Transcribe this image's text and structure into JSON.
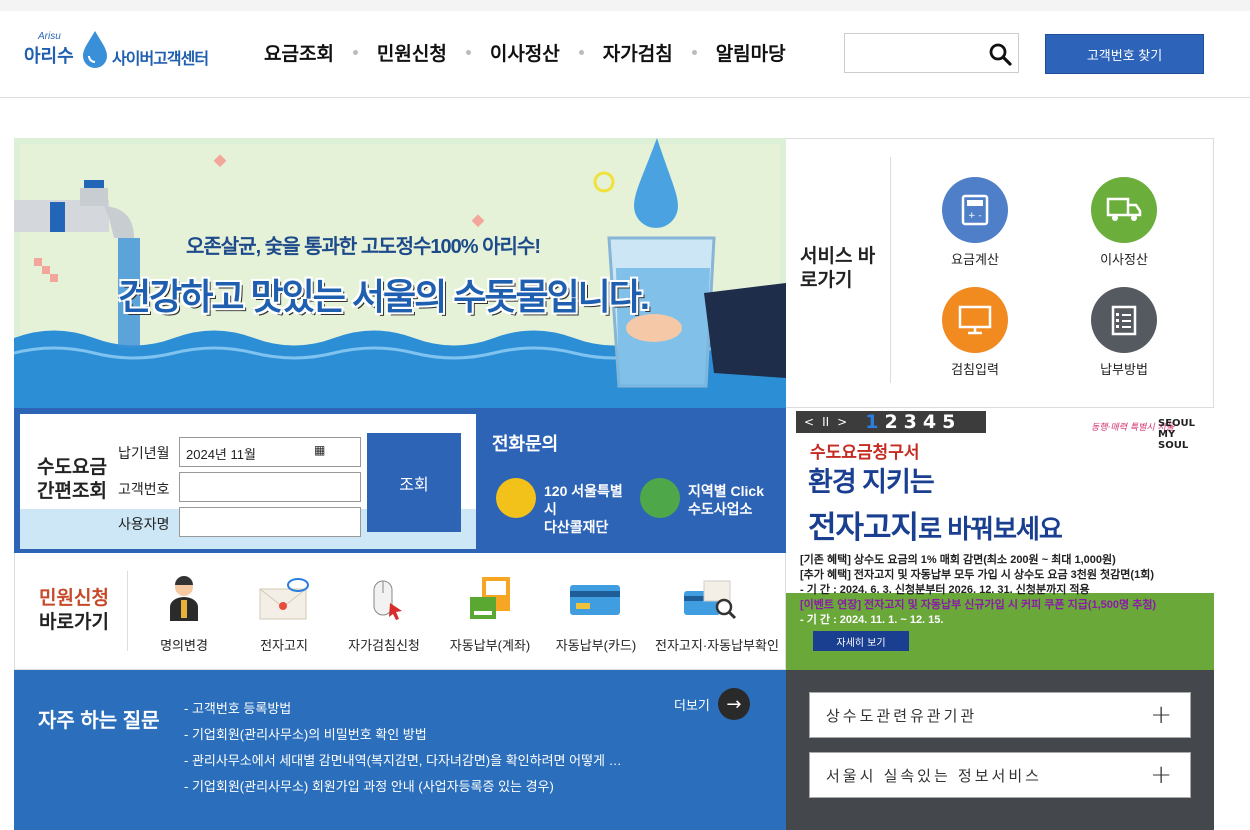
{
  "header": {
    "logo_small": "Arisu",
    "logo_arisu": "아리수",
    "logo_center": "사이버고객센터",
    "nav": [
      "요금조회",
      "민원신청",
      "이사정산",
      "자가검침",
      "알림마당"
    ],
    "search_placeholder": "",
    "customer_button": "고객번호 찾기"
  },
  "banner": {
    "subtitle": "오존살균, 숯을 통과한 고도정수100% 아리수!",
    "main": "건강하고 맛있는 서울의 수돗물입니다."
  },
  "service": {
    "title": "서비스 바로가기",
    "items": [
      {
        "label": "요금계산",
        "color": "#4f7fc8",
        "icon": "calculator-icon"
      },
      {
        "label": "이사정산",
        "color": "#6cae3c",
        "icon": "truck-icon"
      },
      {
        "label": "검침입력",
        "color": "#f18a1f",
        "icon": "monitor-icon"
      },
      {
        "label": "납부방법",
        "color": "#555a61",
        "icon": "checklist-icon"
      }
    ]
  },
  "quick_search": {
    "title": "수도요금 간편조회",
    "fields": [
      {
        "label": "납기년월",
        "value": "2024년 11월"
      },
      {
        "label": "고객번호",
        "value": ""
      },
      {
        "label": "사용자명",
        "value": ""
      }
    ],
    "button": "조회"
  },
  "phone": {
    "title": "전화문의",
    "items": [
      {
        "line1": "120 서울특별시",
        "line2": "다산콜재단"
      },
      {
        "line1": "지역별 Click",
        "line2": "수도사업소"
      }
    ]
  },
  "ebill": {
    "controls": [
      "<",
      "II",
      ">"
    ],
    "pages": [
      "1",
      "2",
      "3",
      "4",
      "5"
    ],
    "active_page": "1",
    "seoul_logo": "동행·매력 특별시 서울",
    "seoul_brand": "SEOUL MY SOUL",
    "title1": "수도요금청구서",
    "title2": "환경 지키는",
    "title3a": "전자고지",
    "title3b": "로 바꿔보세요",
    "lines": [
      "[기존 혜택] 상수도 요금의 1% 매회 감면(최소 200원 ~ 최대 1,000원)",
      "[추가 혜택] 전자고지 및 자동납부 모두 가입 시 상수도 요금 3천원 첫감면(1회)",
      " - 기 간 : 2024. 6. 3. 신청분부터 2026. 12. 31. 신청분까지 적용",
      "[이벤트 연장] 전자고지 및 자동납부 신규가입 시 커피 쿠폰 지급(1,500명 추첨)",
      " - 기 간 : 2024. 11. 1. ~ 12. 15."
    ],
    "detail_button": "자세히 보기"
  },
  "civil": {
    "title_red": "민원신청",
    "title": "바로가기",
    "items": [
      {
        "label": "명의변경",
        "icon": "person-icon"
      },
      {
        "label": "전자고지",
        "icon": "email-icon"
      },
      {
        "label": "자가검침신청",
        "icon": "mouse-icon"
      },
      {
        "label": "자동납부(계좌)",
        "icon": "bankbook-icon"
      },
      {
        "label": "자동납부(카드)",
        "icon": "card-icon"
      },
      {
        "label": "전자고지·자동납부확인",
        "icon": "card-search-icon"
      }
    ]
  },
  "faq": {
    "title": "자주 하는 질문",
    "more": "더보기",
    "items": [
      "- 고객번호 등록방법",
      "- 기업회원(관리사무소)의 비밀번호 확인 방법",
      "- 관리사무소에서 세대별 감면내역(복지감면, 다자녀감면)을 확인하려면 어떻게 …",
      "- 기업회원(관리사무소) 회원가입 과정 안내 (사업자등록증 있는 경우)"
    ]
  },
  "related": {
    "items": [
      "상수도관련유관기관",
      "서울시 실속있는 정보서비스"
    ]
  }
}
